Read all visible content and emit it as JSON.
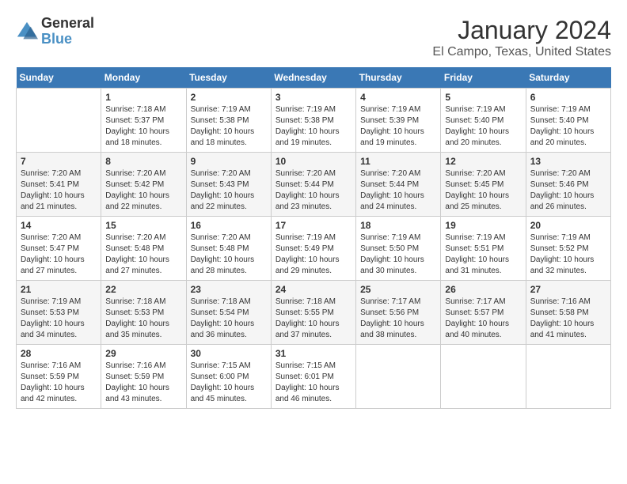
{
  "logo": {
    "text_general": "General",
    "text_blue": "Blue"
  },
  "title": "January 2024",
  "subtitle": "El Campo, Texas, United States",
  "days_of_week": [
    "Sunday",
    "Monday",
    "Tuesday",
    "Wednesday",
    "Thursday",
    "Friday",
    "Saturday"
  ],
  "weeks": [
    [
      {
        "day": "",
        "sunrise": "",
        "sunset": "",
        "daylight": ""
      },
      {
        "day": "1",
        "sunrise": "Sunrise: 7:18 AM",
        "sunset": "Sunset: 5:37 PM",
        "daylight": "Daylight: 10 hours and 18 minutes."
      },
      {
        "day": "2",
        "sunrise": "Sunrise: 7:19 AM",
        "sunset": "Sunset: 5:38 PM",
        "daylight": "Daylight: 10 hours and 18 minutes."
      },
      {
        "day": "3",
        "sunrise": "Sunrise: 7:19 AM",
        "sunset": "Sunset: 5:38 PM",
        "daylight": "Daylight: 10 hours and 19 minutes."
      },
      {
        "day": "4",
        "sunrise": "Sunrise: 7:19 AM",
        "sunset": "Sunset: 5:39 PM",
        "daylight": "Daylight: 10 hours and 19 minutes."
      },
      {
        "day": "5",
        "sunrise": "Sunrise: 7:19 AM",
        "sunset": "Sunset: 5:40 PM",
        "daylight": "Daylight: 10 hours and 20 minutes."
      },
      {
        "day": "6",
        "sunrise": "Sunrise: 7:19 AM",
        "sunset": "Sunset: 5:40 PM",
        "daylight": "Daylight: 10 hours and 20 minutes."
      }
    ],
    [
      {
        "day": "7",
        "sunrise": "Sunrise: 7:20 AM",
        "sunset": "Sunset: 5:41 PM",
        "daylight": "Daylight: 10 hours and 21 minutes."
      },
      {
        "day": "8",
        "sunrise": "Sunrise: 7:20 AM",
        "sunset": "Sunset: 5:42 PM",
        "daylight": "Daylight: 10 hours and 22 minutes."
      },
      {
        "day": "9",
        "sunrise": "Sunrise: 7:20 AM",
        "sunset": "Sunset: 5:43 PM",
        "daylight": "Daylight: 10 hours and 22 minutes."
      },
      {
        "day": "10",
        "sunrise": "Sunrise: 7:20 AM",
        "sunset": "Sunset: 5:44 PM",
        "daylight": "Daylight: 10 hours and 23 minutes."
      },
      {
        "day": "11",
        "sunrise": "Sunrise: 7:20 AM",
        "sunset": "Sunset: 5:44 PM",
        "daylight": "Daylight: 10 hours and 24 minutes."
      },
      {
        "day": "12",
        "sunrise": "Sunrise: 7:20 AM",
        "sunset": "Sunset: 5:45 PM",
        "daylight": "Daylight: 10 hours and 25 minutes."
      },
      {
        "day": "13",
        "sunrise": "Sunrise: 7:20 AM",
        "sunset": "Sunset: 5:46 PM",
        "daylight": "Daylight: 10 hours and 26 minutes."
      }
    ],
    [
      {
        "day": "14",
        "sunrise": "Sunrise: 7:20 AM",
        "sunset": "Sunset: 5:47 PM",
        "daylight": "Daylight: 10 hours and 27 minutes."
      },
      {
        "day": "15",
        "sunrise": "Sunrise: 7:20 AM",
        "sunset": "Sunset: 5:48 PM",
        "daylight": "Daylight: 10 hours and 27 minutes."
      },
      {
        "day": "16",
        "sunrise": "Sunrise: 7:20 AM",
        "sunset": "Sunset: 5:48 PM",
        "daylight": "Daylight: 10 hours and 28 minutes."
      },
      {
        "day": "17",
        "sunrise": "Sunrise: 7:19 AM",
        "sunset": "Sunset: 5:49 PM",
        "daylight": "Daylight: 10 hours and 29 minutes."
      },
      {
        "day": "18",
        "sunrise": "Sunrise: 7:19 AM",
        "sunset": "Sunset: 5:50 PM",
        "daylight": "Daylight: 10 hours and 30 minutes."
      },
      {
        "day": "19",
        "sunrise": "Sunrise: 7:19 AM",
        "sunset": "Sunset: 5:51 PM",
        "daylight": "Daylight: 10 hours and 31 minutes."
      },
      {
        "day": "20",
        "sunrise": "Sunrise: 7:19 AM",
        "sunset": "Sunset: 5:52 PM",
        "daylight": "Daylight: 10 hours and 32 minutes."
      }
    ],
    [
      {
        "day": "21",
        "sunrise": "Sunrise: 7:19 AM",
        "sunset": "Sunset: 5:53 PM",
        "daylight": "Daylight: 10 hours and 34 minutes."
      },
      {
        "day": "22",
        "sunrise": "Sunrise: 7:18 AM",
        "sunset": "Sunset: 5:53 PM",
        "daylight": "Daylight: 10 hours and 35 minutes."
      },
      {
        "day": "23",
        "sunrise": "Sunrise: 7:18 AM",
        "sunset": "Sunset: 5:54 PM",
        "daylight": "Daylight: 10 hours and 36 minutes."
      },
      {
        "day": "24",
        "sunrise": "Sunrise: 7:18 AM",
        "sunset": "Sunset: 5:55 PM",
        "daylight": "Daylight: 10 hours and 37 minutes."
      },
      {
        "day": "25",
        "sunrise": "Sunrise: 7:17 AM",
        "sunset": "Sunset: 5:56 PM",
        "daylight": "Daylight: 10 hours and 38 minutes."
      },
      {
        "day": "26",
        "sunrise": "Sunrise: 7:17 AM",
        "sunset": "Sunset: 5:57 PM",
        "daylight": "Daylight: 10 hours and 40 minutes."
      },
      {
        "day": "27",
        "sunrise": "Sunrise: 7:16 AM",
        "sunset": "Sunset: 5:58 PM",
        "daylight": "Daylight: 10 hours and 41 minutes."
      }
    ],
    [
      {
        "day": "28",
        "sunrise": "Sunrise: 7:16 AM",
        "sunset": "Sunset: 5:59 PM",
        "daylight": "Daylight: 10 hours and 42 minutes."
      },
      {
        "day": "29",
        "sunrise": "Sunrise: 7:16 AM",
        "sunset": "Sunset: 5:59 PM",
        "daylight": "Daylight: 10 hours and 43 minutes."
      },
      {
        "day": "30",
        "sunrise": "Sunrise: 7:15 AM",
        "sunset": "Sunset: 6:00 PM",
        "daylight": "Daylight: 10 hours and 45 minutes."
      },
      {
        "day": "31",
        "sunrise": "Sunrise: 7:15 AM",
        "sunset": "Sunset: 6:01 PM",
        "daylight": "Daylight: 10 hours and 46 minutes."
      },
      {
        "day": "",
        "sunrise": "",
        "sunset": "",
        "daylight": ""
      },
      {
        "day": "",
        "sunrise": "",
        "sunset": "",
        "daylight": ""
      },
      {
        "day": "",
        "sunrise": "",
        "sunset": "",
        "daylight": ""
      }
    ]
  ]
}
